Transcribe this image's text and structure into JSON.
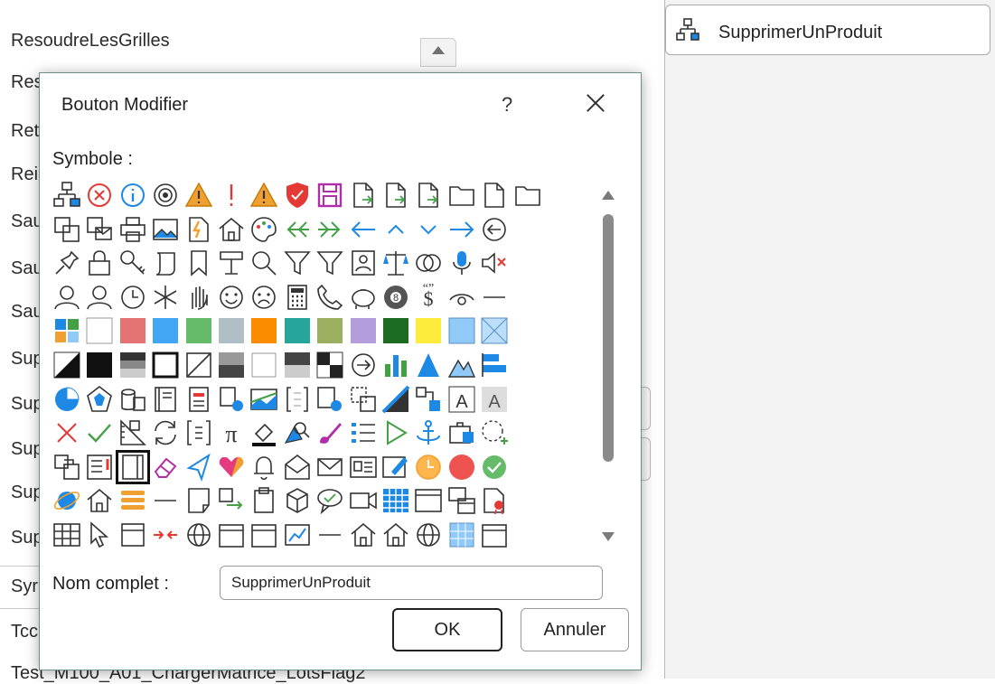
{
  "background_list": {
    "items": [
      "ResoudreLesGrilles",
      "Res",
      "Ret",
      "Rei",
      "Sau",
      "Sau",
      "Sau",
      "Sup",
      "Sup",
      "Sup",
      "Sup",
      "Sup",
      "Syr",
      "Tcc",
      "Test_M100_A01_ChargerMatrice_LotsFlag2"
    ]
  },
  "right_panel": {
    "item_label": "SupprimerUnProduit",
    "item_icon": "hierarchy-icon"
  },
  "dialog": {
    "title": "Bouton Modifier",
    "help_label": "?",
    "symbol_label": "Symbole :",
    "name_label": "Nom complet :",
    "name_value": "SupprimerUnProduit",
    "ok_label": "OK",
    "cancel_label": "Annuler",
    "selected_symbol_index": 122
  },
  "colors": {
    "accent_blue": "#1e88e5",
    "warning_orange": "#f0a030",
    "error_red": "#e53935",
    "success_green": "#43a047",
    "dialog_border": "#6d8f8a"
  },
  "symbols": [
    "hierarchy-icon",
    "error-circle-icon",
    "info-circle-icon",
    "target-icon",
    "warning-icon",
    "exclamation-icon",
    "warning-icon",
    "shield-icon",
    "save-icon",
    "doc-arrow-icon",
    "doc-arrow-icon",
    "doc-arrow-icon",
    "folder-icon",
    "doc-icon",
    "folder-icon",
    "copy-icon",
    "mail-doc-icon",
    "printer-icon",
    "picture-icon",
    "pdf-icon",
    "home-icon",
    "palette-icon",
    "double-left-icon",
    "double-right-icon",
    "arrow-left-icon",
    "chevron-up-icon",
    "chevron-down-icon",
    "arrow-right-icon",
    "circle-left-icon",
    "",
    "pin-icon",
    "lock-icon",
    "key-icon",
    "scroll-icon",
    "bookmark-icon",
    "podium-icon",
    "search-icon",
    "filter-icon",
    "filter-icon",
    "contact-icon",
    "scale-icon",
    "venn-icon",
    "mic-icon",
    "mute-icon",
    "",
    "user-icon",
    "user-icon",
    "clock-icon",
    "snowflake-icon",
    "hand-icon",
    "smile-icon",
    "frown-icon",
    "calculator-icon",
    "phone-icon",
    "piggy-icon",
    "eight-ball-icon",
    "dollar-quote-icon",
    "eye-icon",
    "minus-icon",
    "",
    "color-grid-icon",
    "white-swatch-icon",
    "pink-swatch-icon",
    "blue-swatch-icon",
    "green-swatch-icon",
    "gray-swatch-icon",
    "orange-swatch-icon",
    "teal-swatch-icon",
    "olive-swatch-icon",
    "purple-swatch-icon",
    "darkgreen-swatch-icon",
    "yellow-swatch-icon",
    "lightblue-swatch-icon",
    "pattern-swatch-icon",
    "",
    "diagonal-fill-icon",
    "black-fill-icon",
    "gradient-fill-icon",
    "outline-box-icon",
    "slash-box-icon",
    "half-fill-icon",
    "empty-box-icon",
    "dark-half-icon",
    "checker-icon",
    "circle-arrow-icon",
    "bar-chart-icon",
    "triangle-icon",
    "mountains-icon",
    "align-bars-icon",
    "",
    "pie-icon",
    "radar-icon",
    "cylinders-icon",
    "book-icon",
    "form-icon",
    "shapes-icon",
    "image-icon",
    "bracket-icon",
    "globe-doc-icon",
    "dashed-copy-icon",
    "diagonal-flag-icon",
    "text-flow-icon",
    "text-a-icon",
    "text-a-gray-icon",
    "",
    "close-x-icon",
    "check-icon",
    "ruler-icon",
    "refresh-icon",
    "fields-icon",
    "pi-icon",
    "paint-icon",
    "shape-search-icon",
    "brush-icon",
    "list-icon",
    "play-icon",
    "anchor-icon",
    "toolbox-icon",
    "add-dashed-icon",
    "",
    "copy-alt-icon",
    "note-icon",
    "notebook-icon",
    "eraser-icon",
    "triangle-pen-icon",
    "heart-icon",
    "bell-icon",
    "envelope-open-icon",
    "envelope-icon",
    "card-icon",
    "edit-card-icon",
    "orange-clock-icon",
    "red-circle-icon",
    "green-check-icon",
    "",
    "ie-icon",
    "house-outline-icon",
    "stack-icon",
    "dash-icon",
    "page-icon",
    "swap-icon",
    "clipboard-icon",
    "cube-icon",
    "speech-icon",
    "video-icon",
    "table-icon",
    "window-icon",
    "windows-icon",
    "certificate-icon",
    "",
    "grid-small-icon",
    "cursor-icon",
    "tablet-icon",
    "arrows-icon",
    "globe-icon",
    "box-icon",
    "box-icon",
    "chart-icon",
    "minus-icon",
    "home-icon",
    "home-icon",
    "globe-icon",
    "grid-icon",
    "box-icon",
    ""
  ]
}
